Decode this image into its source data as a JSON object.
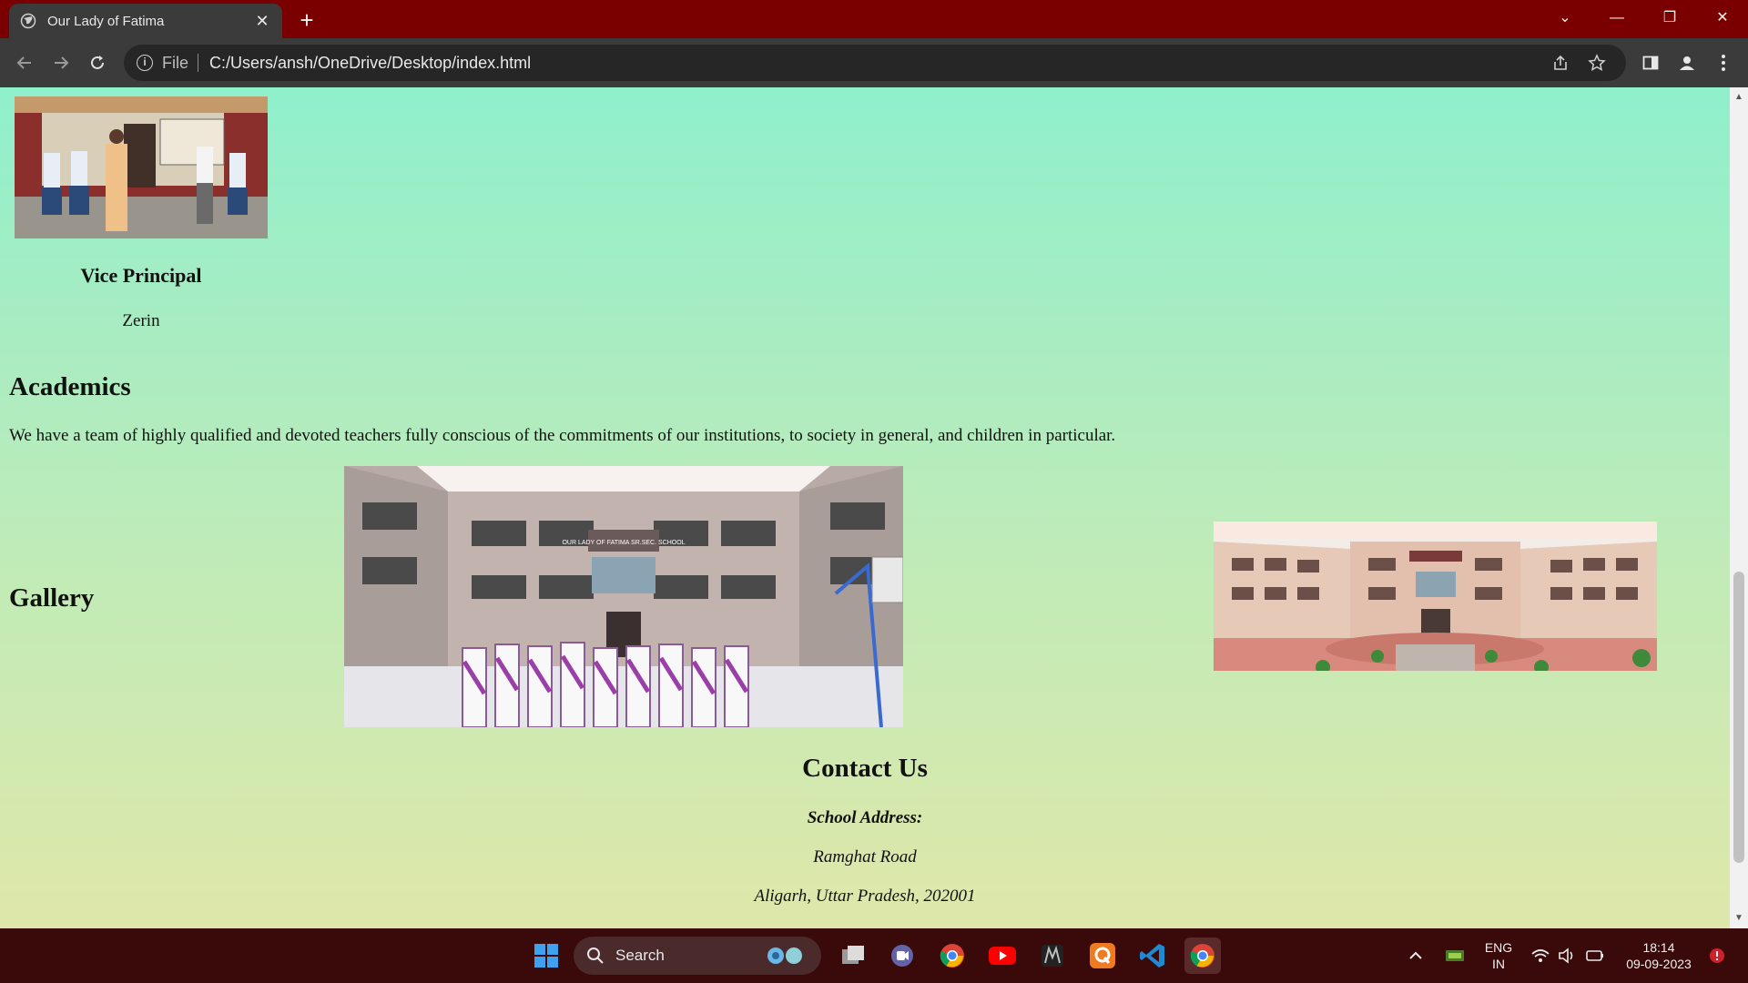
{
  "browser": {
    "tab_title": "Our Lady of Fatima",
    "new_tab": "+",
    "address_scheme": "File",
    "address_url": "C:/Users/ansh/OneDrive/Desktop/index.html"
  },
  "page": {
    "vice_principal": {
      "title": "Vice Principal",
      "name": "Zerin"
    },
    "academics": {
      "heading": "Academics",
      "text": "We have a team of highly qualified and devoted teachers fully conscious of the commitments of our institutions, to society in general, and children in particular."
    },
    "gallery": {
      "heading": "Gallery",
      "banner_text": "OUR LADY OF FATIMA SR.SEC. SCHOOL"
    },
    "contact": {
      "heading": "Contact Us",
      "address_label": "School Address:",
      "address_line1": "Ramghat Road",
      "address_line2": "Aligarh, Uttar Pradesh, 202001"
    }
  },
  "taskbar": {
    "search_label": "Search",
    "lang_line1": "ENG",
    "lang_line2": "IN",
    "time": "18:14",
    "date": "09-09-2023"
  },
  "colors": {
    "titlebar": "#7a0000",
    "toolbar": "#3b3b3b",
    "page_gradient_top": "#8ff0cc",
    "page_gradient_bottom": "#dfe7aa",
    "taskbar": "#3a0a0a"
  }
}
